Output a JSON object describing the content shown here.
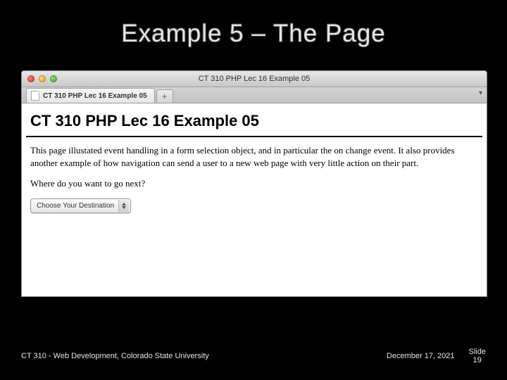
{
  "slide": {
    "title": "Example 5 – The Page",
    "footer_left": "CT 310 - Web Development, Colorado State University",
    "footer_date": "December 17, 2021",
    "footer_slide_label": "Slide",
    "footer_slide_number": "19"
  },
  "browser": {
    "window_title": "CT 310 PHP Lec 16 Example 05",
    "tab_label": "CT 310 PHP Lec 16 Example 05",
    "new_tab_label": "+",
    "menu_glyph": "▾"
  },
  "page": {
    "heading": "CT 310 PHP Lec 16 Example 05",
    "paragraph": "This page illustated event handling in a form selection object, and in particular the on change event. It also provides another example of how navigation can send a user to a new web page with very little action on their part.",
    "prompt": "Where do you want to go next?",
    "select_value": "Choose Your Destination"
  }
}
